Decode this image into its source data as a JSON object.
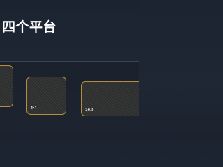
{
  "header": {
    "title": "四个平台"
  },
  "cards": [
    {
      "ratio_label": ""
    },
    {
      "ratio_label": "1:1"
    },
    {
      "ratio_label": "16:9"
    }
  ],
  "colors": {
    "background": "#1f2734",
    "card_border": "#b58d3c",
    "card_fill": "#2b2f31",
    "title_text": "#ffffff"
  }
}
